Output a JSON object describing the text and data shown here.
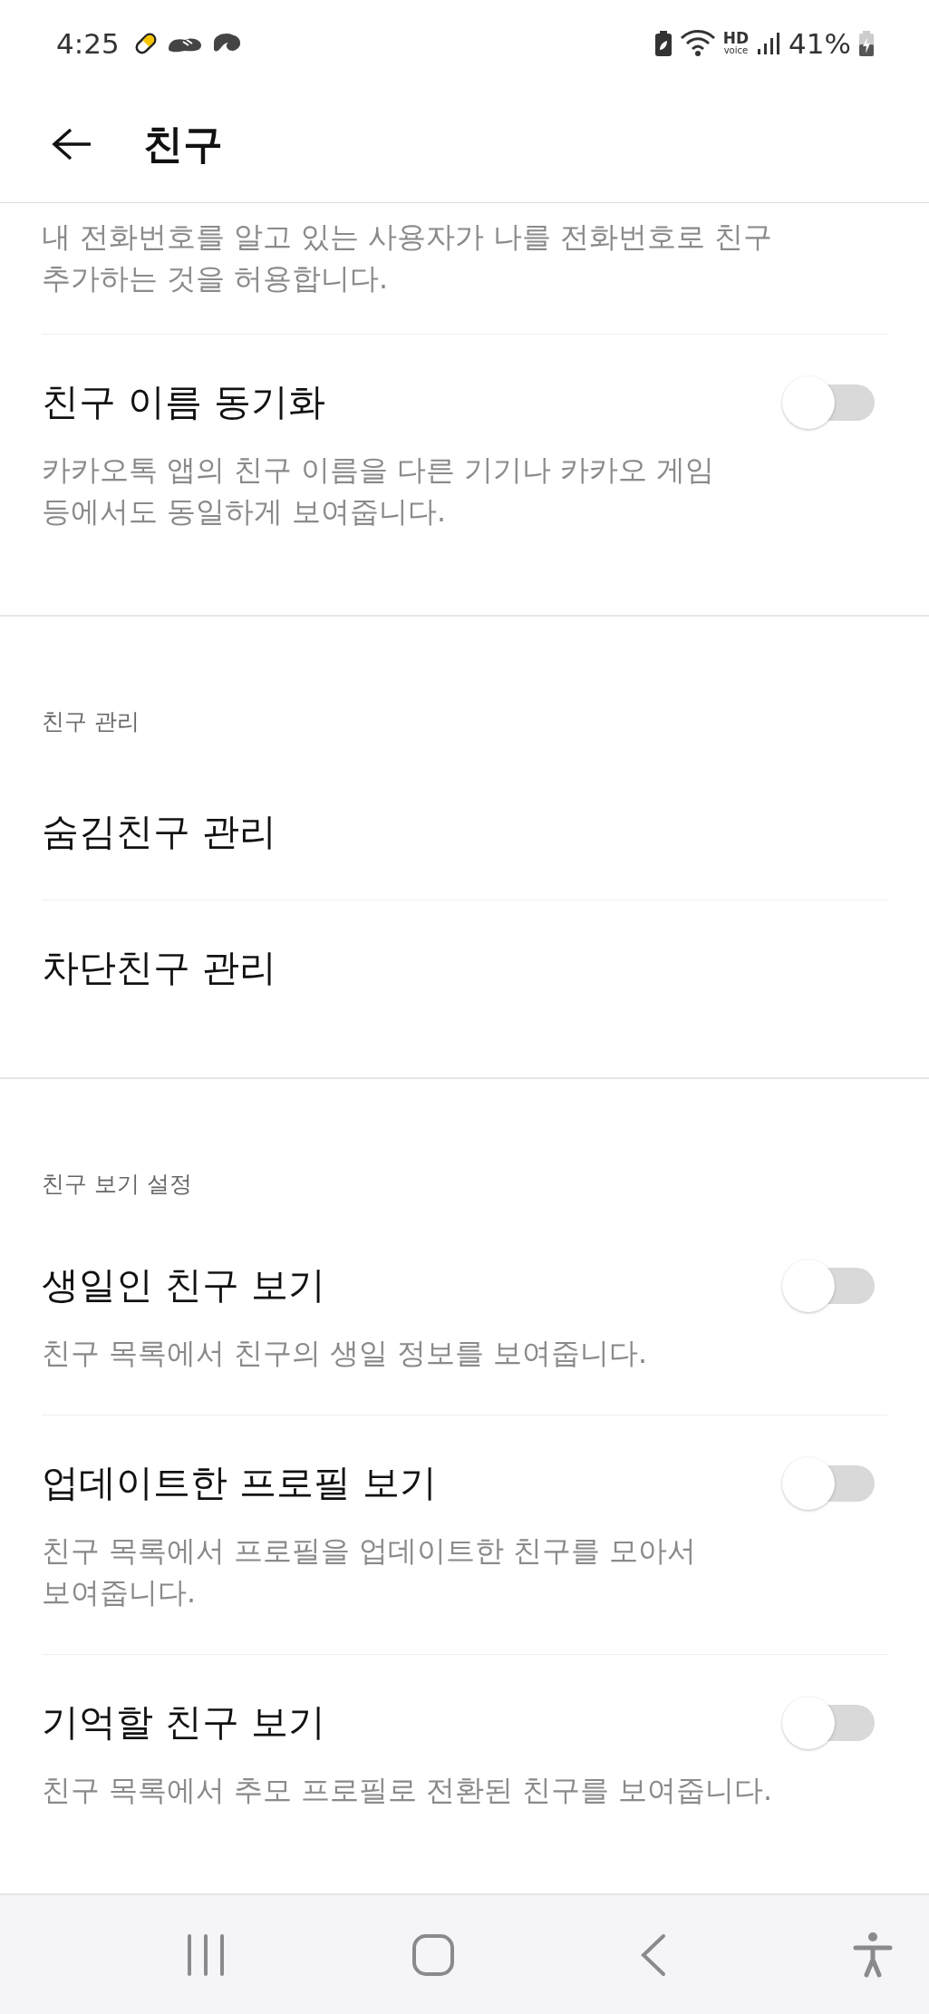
{
  "status_bar": {
    "time": "4:25",
    "hd": "HD",
    "voice": "voice",
    "battery": "41%"
  },
  "header": {
    "title": "친구"
  },
  "sections": [
    {
      "items": [
        {
          "kind": "note",
          "description": "내 전화번호를 알고 있는 사용자가 나를 전화번호로 친구 추가하는 것을 허용합니다."
        },
        {
          "kind": "toggle",
          "title": "친구 이름 동기화",
          "description": "카카오톡 앱의 친구 이름을 다른 기기나 카카오 게임 등에서도 동일하게 보여줍니다.",
          "on": false
        }
      ]
    },
    {
      "title": "친구 관리",
      "items": [
        {
          "kind": "link",
          "title": "숨김친구 관리"
        },
        {
          "kind": "link",
          "title": "차단친구 관리"
        }
      ]
    },
    {
      "title": "친구 보기 설정",
      "items": [
        {
          "kind": "toggle",
          "title": "생일인 친구 보기",
          "description": "친구 목록에서 친구의 생일 정보를 보여줍니다.",
          "on": false
        },
        {
          "kind": "toggle",
          "title": "업데이트한 프로필 보기",
          "description": "친구 목록에서 프로필을 업데이트한 친구를 모아서 보여줍니다.",
          "on": false
        },
        {
          "kind": "toggle",
          "title": "기억할 친구 보기",
          "description": "친구 목록에서 추모 프로필로 전환된 친구를 보여줍니다.",
          "on": false
        }
      ]
    }
  ]
}
